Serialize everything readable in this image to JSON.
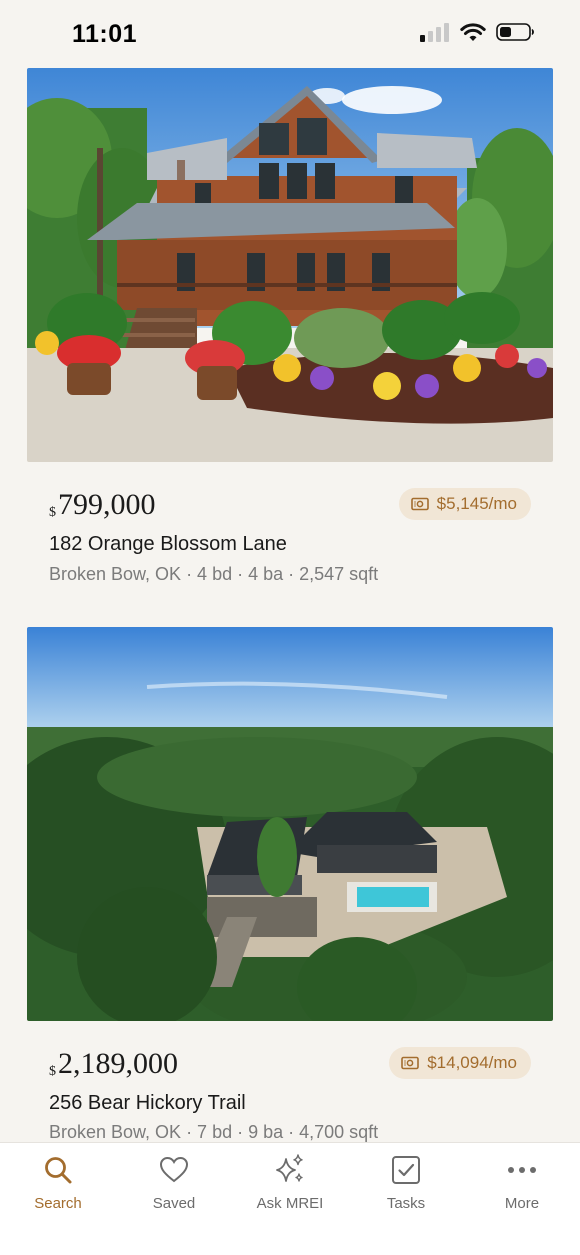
{
  "status_bar": {
    "time": "11:01"
  },
  "listings": [
    {
      "currency": "$",
      "price": "799,000",
      "mortgage": "$5,145/mo",
      "address": "182 Orange Blossom Lane",
      "details": "Broken Bow, OK · 4 bd · 4 ba · 2,547 sqft"
    },
    {
      "currency": "$",
      "price": "2,189,000",
      "mortgage": "$14,094/mo",
      "address": "256 Bear Hickory Trail",
      "details": "Broken Bow, OK · 7 bd · 9 ba · 4,700 sqft"
    }
  ],
  "nav": {
    "items": [
      {
        "label": "Search",
        "icon": "search-icon",
        "active": true
      },
      {
        "label": "Saved",
        "icon": "heart-icon",
        "active": false
      },
      {
        "label": "Ask MREI",
        "icon": "sparkles-icon",
        "active": false
      },
      {
        "label": "Tasks",
        "icon": "checkbox-icon",
        "active": false
      },
      {
        "label": "More",
        "icon": "more-dots-icon",
        "active": false
      }
    ]
  },
  "colors": {
    "accent": "#a36d2e",
    "pill_bg": "#f1e6d6",
    "background": "#f6f4f0"
  }
}
